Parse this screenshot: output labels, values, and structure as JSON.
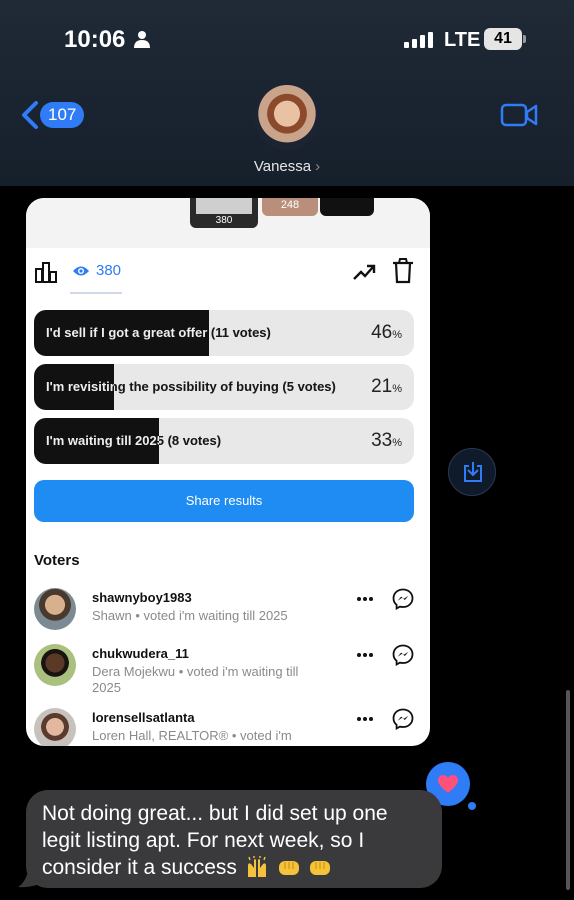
{
  "status_bar": {
    "time": "10:06",
    "network": "LTE",
    "battery": "41"
  },
  "conversation": {
    "back_count": "107",
    "contact_name": "Vanessa",
    "chevron": "›"
  },
  "shared_image": {
    "thumb_counts": [
      "380",
      "248"
    ],
    "views": "380",
    "poll_options": [
      {
        "label": "I'd sell if I got a great offer (11 votes)",
        "percent": "46",
        "fill_fraction": 0.46
      },
      {
        "label": "I'm revisiting the possibility of buying (5 votes)",
        "percent": "21",
        "fill_fraction": 0.21
      },
      {
        "label": "I'm waiting till 2025 (8 votes)",
        "percent": "33",
        "fill_fraction": 0.33
      }
    ],
    "percent_sign": "%",
    "share_button": "Share results",
    "voters_title": "Voters",
    "voters": [
      {
        "username": "shawnyboy1983",
        "subtitle": "Shawn • voted i'm waiting till 2025"
      },
      {
        "username": "chukwudera_11",
        "subtitle": "Dera Mojekwu • voted i'm waiting till 2025"
      },
      {
        "username": "lorensellsatlanta",
        "subtitle": "Loren Hall, REALTOR® • voted i'm revisiting the possibility of buying"
      }
    ]
  },
  "message": {
    "text": "Not doing great... but I did set up one legit listing apt. For next week, so I consider it a success"
  },
  "colors": {
    "accent": "#2f7cf6",
    "bubble": "#3a3a3c",
    "header": "#1f2a36"
  }
}
